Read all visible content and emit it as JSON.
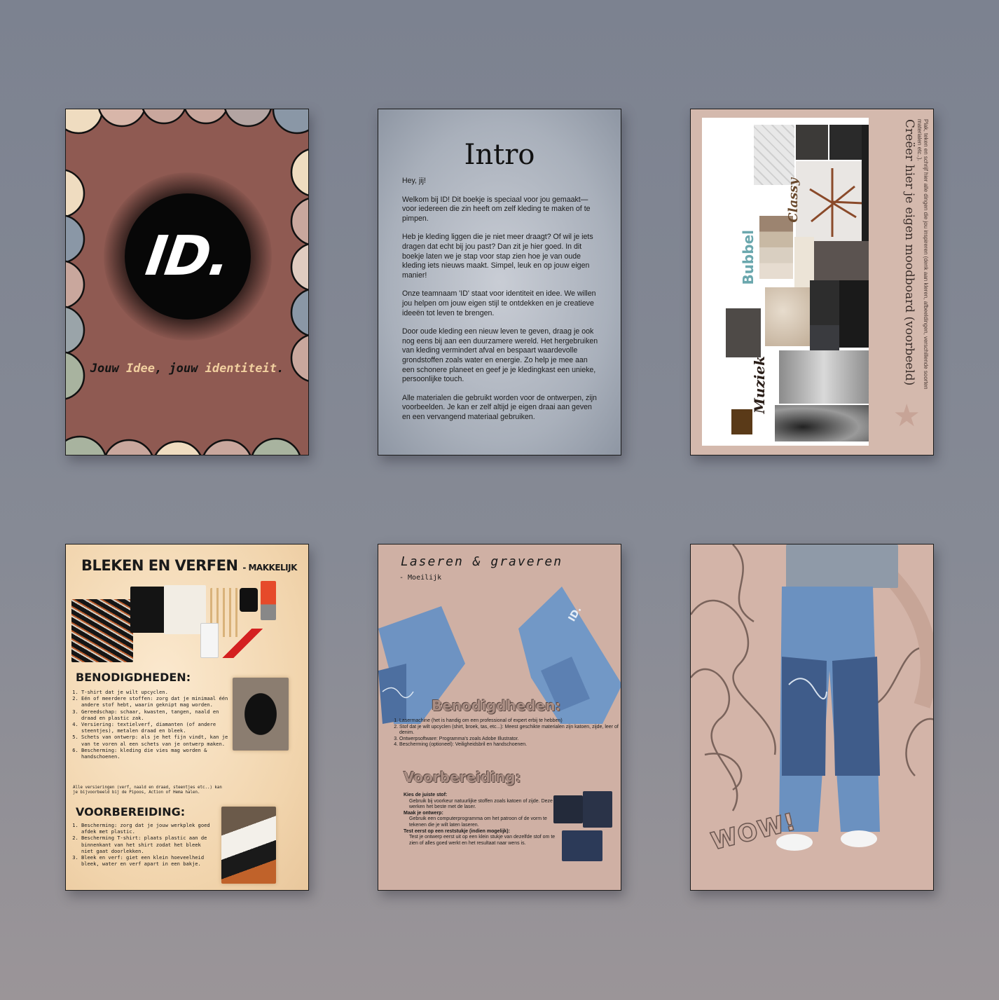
{
  "pages": {
    "cover": {
      "logo": "ID.",
      "tagline_part1": "Jouw ",
      "tagline_part2": "Idee",
      "tagline_part3": ", jouw ",
      "tagline_part4": "identiteit",
      "tagline_part5": "."
    },
    "intro": {
      "title": "Intro",
      "paragraphs": [
        "Hey, jij!",
        "Welkom bij ID! Dit boekje is speciaal voor jou gemaakt—voor iedereen die zin heeft om zelf kleding te maken of te pimpen.",
        "Heb je kleding liggen die je niet meer draagt? Of wil je iets dragen dat echt bij jou past? Dan zit je hier goed. In dit boekje laten we je stap voor stap zien hoe je van oude kleding iets nieuws maakt. Simpel, leuk en op jouw eigen manier!",
        "Onze teamnaam 'ID' staat voor identiteit en idee. We willen jou helpen om jouw eigen stijl te ontdekken en je creatieve ideeën tot leven te brengen.",
        "Door oude kleding een nieuw leven te geven, draag je ook nog eens bij aan een duurzamere wereld. Het hergebruiken van kleding vermindert afval en bespaart waardevolle grondstoffen zoals water en energie. Zo help je mee aan een schonere planeet en geef je je kledingkast een unieke, persoonlijke touch.",
        "Alle materialen die gebruikt worden voor de ontwerpen, zijn voorbeelden. Je kan er zelf altijd je eigen draai aan geven en een vervangend materiaal gebruiken."
      ]
    },
    "moodboard": {
      "title": "Creëer hier je eigen moodboard (voorbeeld)",
      "subtitle": "Plak, teken en schrijf hier alle dingen die jou inspireren (denk aan kleren, afbeeldingen, verschillende soorten materialen etc..).",
      "words": [
        "Classy",
        "Bubbel",
        "Muziek"
      ]
    },
    "bleken": {
      "title": "BLEKEN EN VERFEN",
      "level": "- MAKKELIJK",
      "heading_needs": "BENODIGDHEDEN:",
      "needs": [
        "T-shirt dat je wilt upcyclen.",
        "Eén of meerdere stoffen: zorg dat je minimaal één andere stof hebt, waarin geknipt mag worden.",
        "Gereedschap: schaar, kwasten, tangen, naald en draad en plastic zak.",
        "Versiering: textielverf, diamanten (of andere steentjes), metalen draad en bleek.",
        "Schets van ontwerp: als je het fijn vindt, kan je van te voren al een schets van je ontwerp maken.",
        "Bescherming: kleding die vies mag worden & handschoenen."
      ],
      "note": "Alle versieringen (verf, naald en draad, steentjes etc..) kan je bijvoorbeeld bij de Pipoos, Action of Hema halen.",
      "heading_prep": "VOORBEREIDING:",
      "prep": [
        "Bescherming: zorg dat je jouw werkplek goed afdek met plastic.",
        "Bescherming T-shirt: plaats plastic aan de binnenkant van het shirt zodat het bleek niet gaat doorlekken.",
        "Bleek en verf: giet een klein hoeveelheid bleek, water en verf apart in een bakje."
      ]
    },
    "laseren": {
      "title": "Laseren & graveren",
      "level": "- Moeilijk",
      "heading_needs": "Benodigdheden:",
      "needs": [
        "Lasermachine (het is handig om een professional of expert erbij te hebben)",
        "Stof dat je wilt upcyclen (shirt, broek, tas, etc...): Meest geschikte materialen zijn katoen, zijde, leer of denim.",
        "Ontwerpsoftware: Programma's zoals Adobe Illustrator.",
        "Bescherming (optioneel): Veiligheidsbril en handschoenen."
      ],
      "heading_prep": "Voorbereiding:",
      "prep": [
        "Kies de juiste stof:",
        "Gebruik bij voorkeur natuurlijke stoffen zoals katoen of zijde. Deze werken het beste met de laser.",
        "Maak je ontwerp:",
        "Gebruik een computerprogramma om het patroon of de vorm te tekenen die je wilt laten laseren.",
        "Test eerst op een reststukje (indien mogelijk):",
        "Test je ontwerp eerst uit op een klein stukje van dezelfde stof om te zien of alles goed werkt en het resultaat naar wens is."
      ],
      "jeans_logo": "ID."
    },
    "wow": {
      "label": "WOW!"
    }
  },
  "colors": {
    "background": "#868a95",
    "cover": "#8f5a52",
    "intro": "#a9b0bb",
    "moodboard": "#d4b9ad",
    "bleken": "#f1d4ac",
    "laseren": "#cfb0a4",
    "wow": "#d3b4a8",
    "accent": "#f1cf9f"
  }
}
